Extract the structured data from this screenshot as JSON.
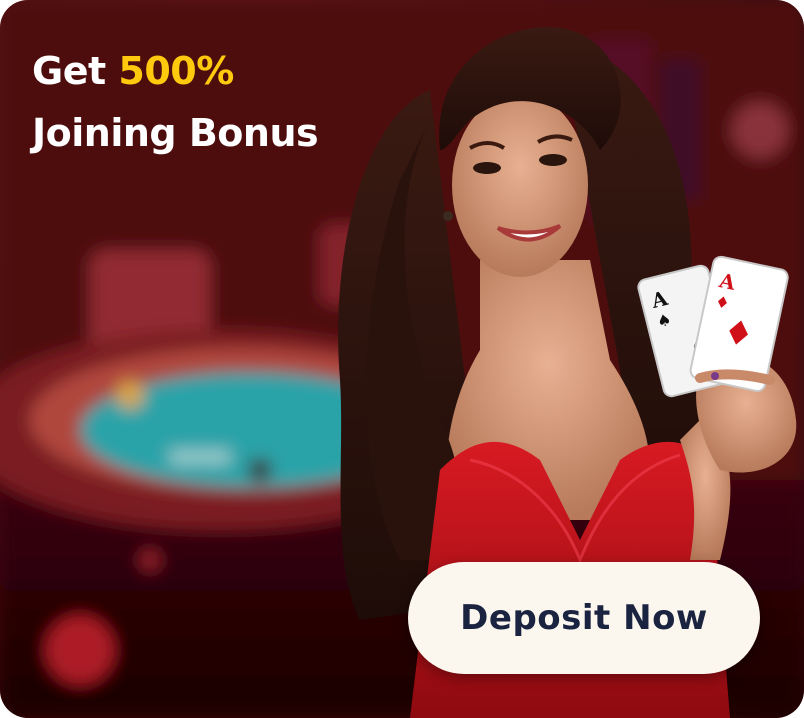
{
  "promo": {
    "headline_prefix": "Get",
    "headline_highlight": "500%",
    "headline_line2": "Joining Bonus",
    "cta_label": "Deposit Now"
  },
  "colors": {
    "background": "#4a070c",
    "accent": "#ffc90e",
    "headline_text": "#ffffff",
    "button_bg": "#fbf6ee",
    "button_text": "#1a2340",
    "dress": "#c4101a",
    "table_felt": "#2aa3a8"
  },
  "icons": {
    "cards": "playing-cards-icon"
  }
}
